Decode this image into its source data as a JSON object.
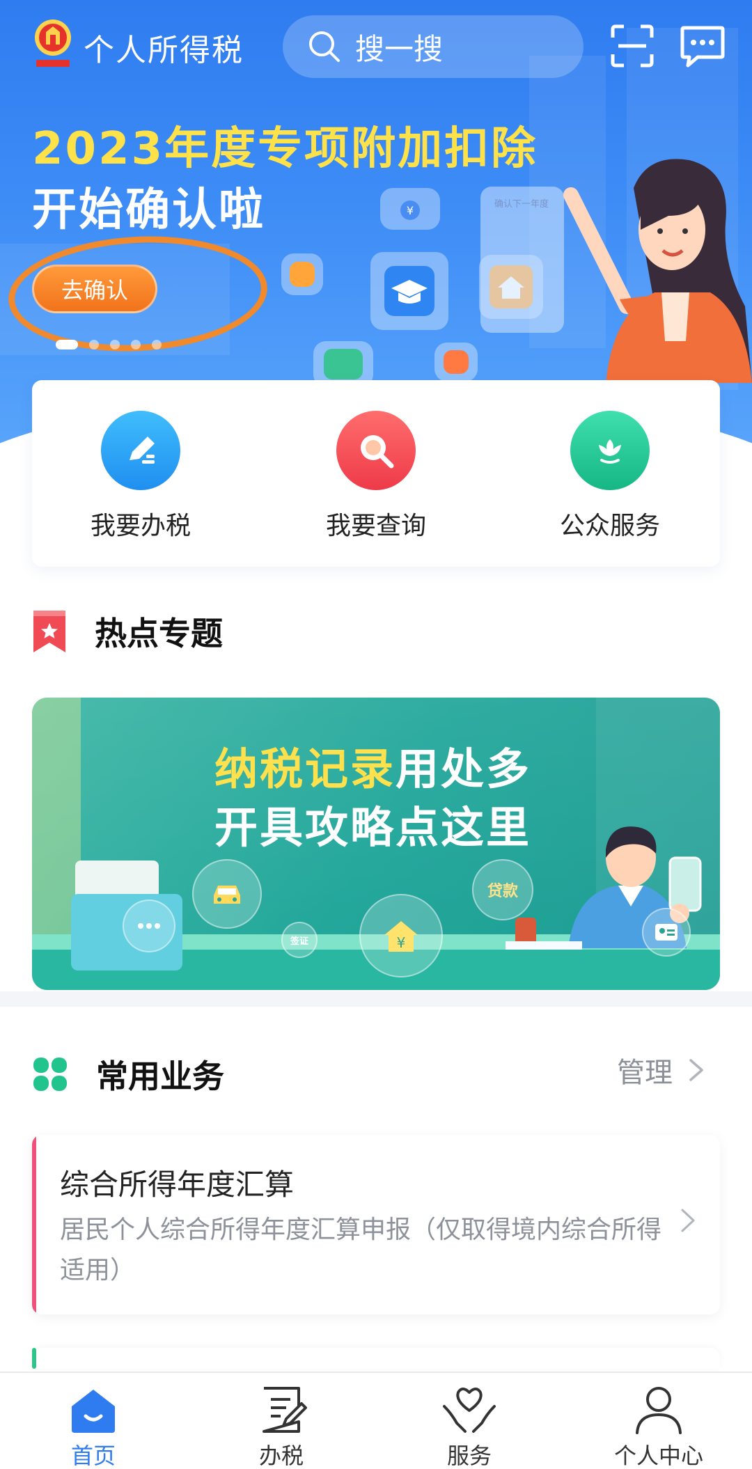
{
  "header": {
    "app_title": "个人所得税",
    "search_placeholder": "搜一搜"
  },
  "hero_banner": {
    "line1_year": "2023年度",
    "line1_highlight": "专项附加扣除",
    "line2": "开始确认啦",
    "button_label": "去确认",
    "board_caption": "确认下一年度"
  },
  "quick_actions": [
    {
      "label": "我要办税",
      "icon": "pen-edit-icon",
      "color": "#29a8f5"
    },
    {
      "label": "我要查询",
      "icon": "magnifier-icon",
      "color": "#f4535a"
    },
    {
      "label": "公众服务",
      "icon": "lotus-icon",
      "color": "#23cc98"
    }
  ],
  "hot_topics": {
    "title": "热点专题",
    "banner": {
      "line1_highlight": "纳税记录",
      "line1_rest": "用处多",
      "line2": "开具攻略点这里",
      "bubbles": [
        "贷款",
        "签证"
      ]
    }
  },
  "common_business": {
    "title": "常用业务",
    "manage_label": "管理",
    "items": [
      {
        "title": "综合所得年度汇算",
        "description": "居民个人综合所得年度汇算申报（仅取得境内综合所得适用）"
      }
    ]
  },
  "tab_bar": {
    "tabs": [
      {
        "label": "首页",
        "icon": "home-icon",
        "active": true
      },
      {
        "label": "办税",
        "icon": "document-pen-icon",
        "active": false
      },
      {
        "label": "服务",
        "icon": "heart-hands-icon",
        "active": false
      },
      {
        "label": "个人中心",
        "icon": "person-icon",
        "active": false
      }
    ]
  },
  "colors": {
    "brand_blue": "#2f7cf0",
    "accent_yellow": "#ffe24a",
    "annotation_orange": "#f08a2c",
    "topic_teal": "#23a79b"
  }
}
